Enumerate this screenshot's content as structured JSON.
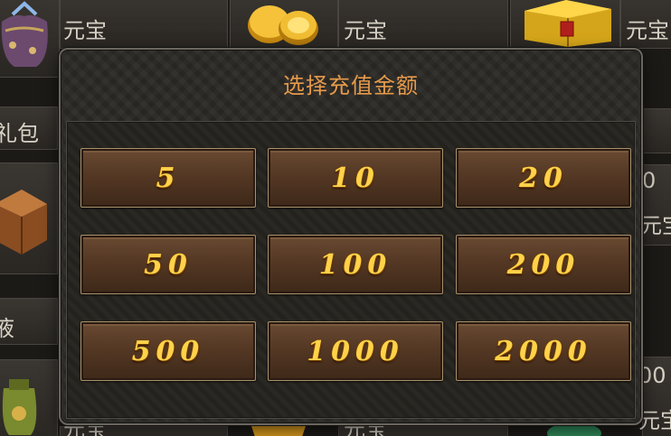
{
  "background": {
    "currency_label": "元宝",
    "gift_pack_label_partial": "礼包",
    "liquid_label_partial": "液",
    "right_partial_texts": [
      "0",
      "元宝",
      "00",
      "元宝"
    ]
  },
  "modal": {
    "title": "选择充值金额"
  },
  "amounts": [
    "5",
    "10",
    "20",
    "50",
    "100",
    "200",
    "500",
    "1000",
    "2000"
  ],
  "colors": {
    "title": "#e59a4a",
    "amount_text": "#ffd24a",
    "button_border": "#a8916b"
  }
}
